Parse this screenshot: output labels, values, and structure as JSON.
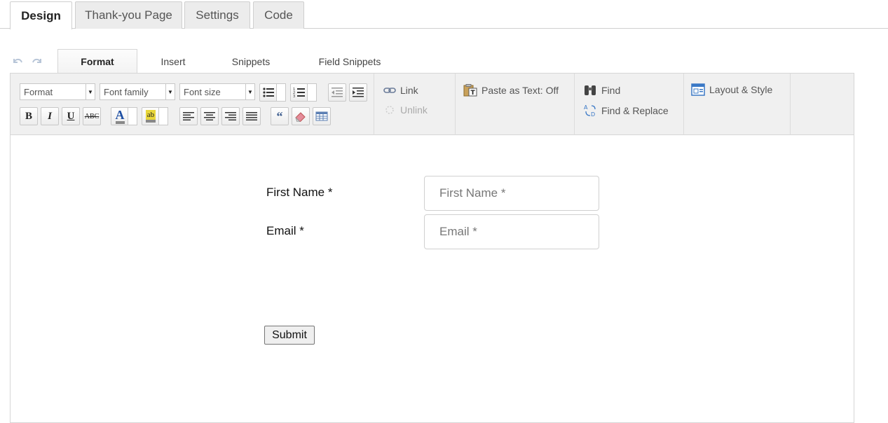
{
  "top_tabs": [
    {
      "label": "Design",
      "active": true
    },
    {
      "label": "Thank-you Page",
      "active": false
    },
    {
      "label": "Settings",
      "active": false
    },
    {
      "label": "Code",
      "active": false
    }
  ],
  "editor_tabs": [
    {
      "label": "Format",
      "active": true
    },
    {
      "label": "Insert",
      "active": false
    },
    {
      "label": "Snippets",
      "active": false
    },
    {
      "label": "Field Snippets",
      "active": false
    }
  ],
  "toolbar": {
    "format_select": "Format",
    "font_family_select": "Font family",
    "font_size_select": "Font size",
    "link": "Link",
    "unlink": "Unlink",
    "paste_as_text": "Paste as Text: Off",
    "find": "Find",
    "find_replace": "Find & Replace",
    "layout_style": "Layout & Style",
    "bold": "B",
    "italic": "I",
    "underline": "U",
    "strikethrough": "ABC",
    "font_color": "A",
    "highlight": "ab"
  },
  "form": {
    "first_name_label": "First Name *",
    "first_name_placeholder": "First Name *",
    "email_label": "Email *",
    "email_placeholder": "Email *",
    "submit_label": "Submit"
  },
  "colors": {
    "accent_blue": "#3a78c6",
    "font_color_bar": "#1e4fa3",
    "highlight_bar": "#e8d63a"
  }
}
